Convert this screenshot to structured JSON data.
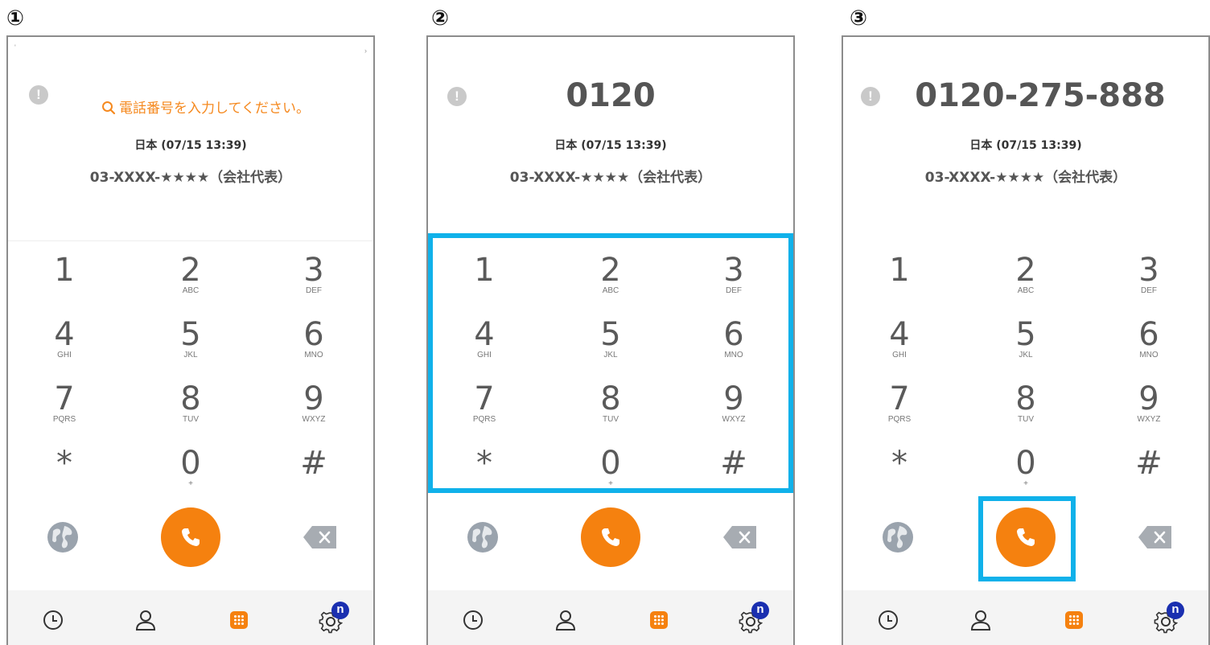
{
  "steps": [
    "①",
    "②",
    "③"
  ],
  "screens": [
    {
      "number_display": "",
      "search_hint": "電話番号を入力してください。"
    },
    {
      "number_display": "0120"
    },
    {
      "number_display": "0120-275-888"
    }
  ],
  "top_marks": {
    "left": "'",
    "right": "›"
  },
  "info_icon": "!",
  "country_time": "日本 (07/15 13:39)",
  "caller_id": "03-XXXX-★★★★（会社代表）",
  "keypad": [
    {
      "digit": "1",
      "letters": ""
    },
    {
      "digit": "2",
      "letters": "ABC"
    },
    {
      "digit": "3",
      "letters": "DEF"
    },
    {
      "digit": "4",
      "letters": "GHI"
    },
    {
      "digit": "5",
      "letters": "JKL"
    },
    {
      "digit": "6",
      "letters": "MNO"
    },
    {
      "digit": "7",
      "letters": "PQRS"
    },
    {
      "digit": "8",
      "letters": "TUV"
    },
    {
      "digit": "9",
      "letters": "WXYZ"
    },
    {
      "digit": "*",
      "letters": ""
    },
    {
      "digit": "0",
      "letters": "+"
    },
    {
      "digit": "#",
      "letters": ""
    }
  ],
  "settings_badge": "n",
  "colors": {
    "accent_orange": "#f5810f",
    "hint_orange": "#f5891f",
    "highlight_blue": "#10b1ea",
    "frame_gray": "#8c8c8c"
  },
  "icons": {
    "search": "search-icon",
    "info": "info-icon",
    "globe": "globe-icon",
    "call": "phone-icon",
    "backspace": "backspace-icon",
    "history": "clock-icon",
    "contacts": "person-icon",
    "dialpad": "dialpad-icon",
    "settings": "gear-icon"
  }
}
